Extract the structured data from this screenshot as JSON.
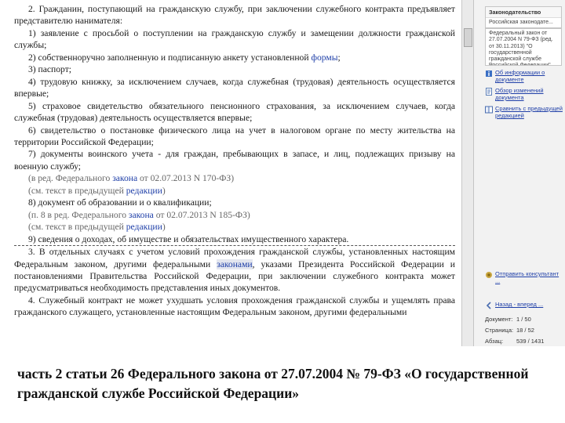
{
  "document": {
    "paragraphs": [
      {
        "id": "p2",
        "text": "2. Гражданин, поступающий на гражданскую службу, при заключении служебного контракта предъявляет представителю нанимателя:"
      },
      {
        "id": "p2_1",
        "text": "1) заявление с просьбой о поступлении на гражданскую службу и замещении должности гражданской службы;"
      },
      {
        "id": "p2_2a",
        "text": "2) собственноручно заполненную и подписанную анкету установленной ",
        "link": "формы",
        "tail": ";"
      },
      {
        "id": "p2_3",
        "text": "3) паспорт;"
      },
      {
        "id": "p2_4",
        "text": "4) трудовую книжку, за исключением случаев, когда служебная (трудовая) деятельность осуществляется впервые;"
      },
      {
        "id": "p2_5",
        "text": "5) страховое свидетельство обязательного пенсионного страхования, за исключением случаев, когда служебная (трудовая) деятельность осуществляется впервые;"
      },
      {
        "id": "p2_6",
        "text": "6) свидетельство о постановке физического лица на учет в налоговом органе по месту жительства на территории Российской Федерации;"
      },
      {
        "id": "p2_7",
        "text": "7) документы воинского учета - для граждан, пребывающих в запасе, и лиц, подлежащих призыву на военную службу;"
      }
    ],
    "note1_prefix": "(в ред. Федерального ",
    "note1_link": "закона",
    "note1_suffix": " от 02.07.2013 N 170-ФЗ)",
    "note2_prefix": "(см. текст в предыдущей ",
    "note2_link": "редакции",
    "note2_suffix": ")",
    "p2_8": "8) документ об образовании и о квалификации;",
    "note3_prefix": "(п. 8 в ред. Федерального ",
    "note3_link": "закона",
    "note3_suffix": " от 02.07.2013 N 185-ФЗ)",
    "note4_prefix": "(см. текст в предыдущей ",
    "note4_link": "редакции",
    "note4_suffix": ")",
    "p2_9": "9) сведения о доходах, об имуществе и обязательствах имущественного характера.",
    "p3_a": "3. В отдельных случаях с учетом условий прохождения гражданской службы, установленных настоящим Федеральным законом, другими федеральными ",
    "p3_link": "законами",
    "p3_b": ", указами Президента Российской Федерации и постановлениями Правительства Российской Федерации, при заключении служебного контракта может предусматриваться необходимость представления иных документов.",
    "p4": "4. Служебный контракт не может ухудшать условия прохождения гражданской службы и ущемлять права гражданского служащего, установленные настоящим Федеральным законом, другими федеральными"
  },
  "right_panel": {
    "card1_title": "Законодательство",
    "card1_body": "Российская законодате...",
    "card2_title": "Федеральный закон от 27.07.2004 N 79-ФЗ (ред. от 30.11.2013) \"О государственной гражданской службе Российской Федерации\"",
    "links": [
      "Об информации о документе",
      "Обзор изменений документа",
      "Сравнить с предыдущей редакцией"
    ],
    "consult_label": "Отправить консультант ...",
    "back_label": "Назад - вперед ...",
    "document_label": "Документ:",
    "document_value": "1 / 50",
    "page_label": "Страница:",
    "page_value": "18 / 52",
    "para_label": "Абзац:",
    "para_value": "539 / 1431"
  },
  "caption": "часть 2 статьи 26 Федерального закона от 27.07.2004 № 79-ФЗ «О государственной гражданской службе Российской Федерации»"
}
